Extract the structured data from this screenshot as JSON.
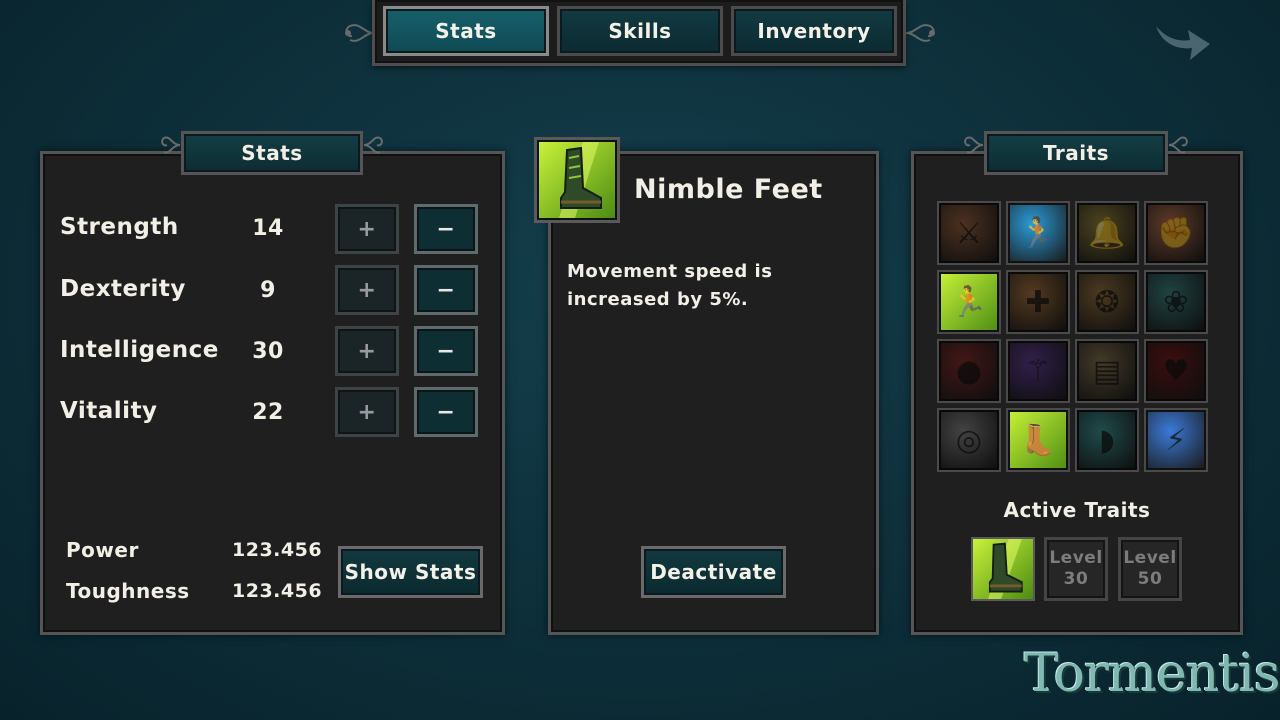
{
  "tabs": [
    {
      "label": "Stats",
      "active": true
    },
    {
      "label": "Skills",
      "active": false
    },
    {
      "label": "Inventory",
      "active": false
    }
  ],
  "exit_icon": "curved-arrow-icon",
  "stats_panel": {
    "title": "Stats",
    "stats": [
      {
        "label": "Strength",
        "value": "14"
      },
      {
        "label": "Dexterity",
        "value": "9"
      },
      {
        "label": "Intelligence",
        "value": "30"
      },
      {
        "label": "Vitality",
        "value": "22"
      }
    ],
    "plus_label": "+",
    "minus_label": "−",
    "summary": [
      {
        "label": "Power",
        "value": "123.456"
      },
      {
        "label": "Toughness",
        "value": "123.456"
      }
    ],
    "show_stats_button": "Show Stats"
  },
  "detail_panel": {
    "icon": "boot-icon",
    "title": "Nimble Feet",
    "description": "Movement speed is increased by 5%.",
    "button": "Deactivate"
  },
  "traits_panel": {
    "title": "Traits",
    "grid": [
      {
        "icon": "crossed-swords-icon",
        "color": "#8a5a3a",
        "dim": true
      },
      {
        "icon": "leaping-figure-icon",
        "color": "#2a9bd8",
        "dim": false
      },
      {
        "icon": "bell-icon",
        "color": "#8a7a3a",
        "dim": true
      },
      {
        "icon": "flexed-arm-icon",
        "color": "#a86a4a",
        "dim": true
      },
      {
        "icon": "running-figure-icon",
        "color": "#8ccf2a",
        "dim": false
      },
      {
        "icon": "cross-shield-icon",
        "color": "#9a6a3a",
        "dim": true
      },
      {
        "icon": "swirl-lock-icon",
        "color": "#8a6a3a",
        "dim": true
      },
      {
        "icon": "paw-icon",
        "color": "#3a7a7a",
        "dim": true
      },
      {
        "icon": "apple-icon",
        "color": "#7a2a2a",
        "dim": true
      },
      {
        "icon": "staff-hand-icon",
        "color": "#5a3a8a",
        "dim": true
      },
      {
        "icon": "cards-icon",
        "color": "#7a6a4a",
        "dim": true
      },
      {
        "icon": "heart-sigil-icon",
        "color": "#6a1a1a",
        "dim": true
      },
      {
        "icon": "vortex-icon",
        "color": "#7a7a7a",
        "dim": true
      },
      {
        "icon": "boot-icon",
        "color": "#9ad22a",
        "dim": false
      },
      {
        "icon": "blade-icon",
        "color": "#3a8a8a",
        "dim": true
      },
      {
        "icon": "lightning-sword-icon",
        "color": "#3a7ad8",
        "dim": false
      }
    ],
    "active_title": "Active Traits",
    "active_slots": [
      {
        "type": "icon",
        "icon": "boot-icon"
      },
      {
        "type": "locked",
        "label": "Level",
        "level": "30"
      },
      {
        "type": "locked",
        "label": "Level",
        "level": "50"
      }
    ]
  },
  "logo_text": "Tormentis"
}
